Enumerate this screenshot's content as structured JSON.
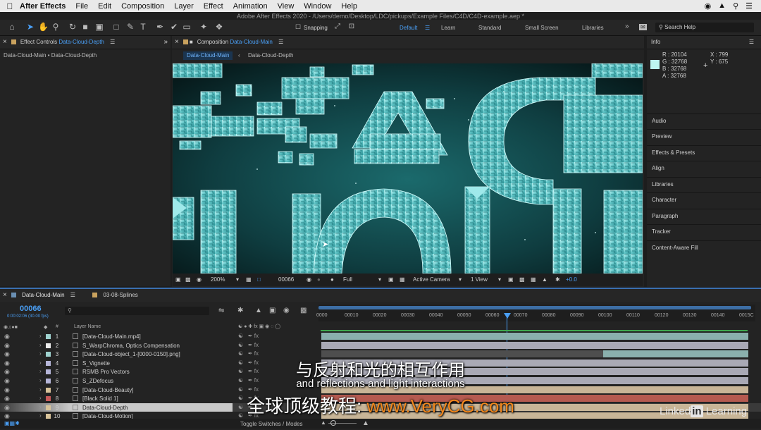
{
  "menubar": {
    "app_name": "After Effects",
    "items": [
      "File",
      "Edit",
      "Composition",
      "Layer",
      "Effect",
      "Animation",
      "View",
      "Window",
      "Help"
    ]
  },
  "window_title": "Adobe After Effects 2020 - /Users/demo/Desktop/LDC/pickups/Example Files/C4D/C4D-example.aep *",
  "toolbar": {
    "snapping": "Snapping",
    "workspaces": [
      "Default",
      "Learn",
      "Standard",
      "Small Screen",
      "Libraries"
    ],
    "active_workspace": "Default",
    "search_placeholder": "Search Help"
  },
  "effect_controls": {
    "header_prefix": "Effect Controls",
    "header_layer": "Data-Cloud-Depth",
    "breadcrumb": "Data-Cloud-Main • Data-Cloud-Depth"
  },
  "composition": {
    "header_prefix": "Composition",
    "header_name": "Data-Cloud-Main",
    "tabs": [
      "Data-Cloud-Main",
      "Data-Cloud-Depth"
    ],
    "zoom": "200%",
    "timecode": "00066",
    "resolution": "Full",
    "camera": "Active Camera",
    "view": "1 View",
    "exposure": "+0.0"
  },
  "info": {
    "title": "Info",
    "r": "R : 20104",
    "g": "G : 32768",
    "b": "B : 32768",
    "a": "A : 32768",
    "x": "X : 799",
    "y": "Y : 675",
    "swatch_color": "#bdf5f0"
  },
  "right_panels": [
    "Audio",
    "Preview",
    "Effects & Presets",
    "Align",
    "Libraries",
    "Character",
    "Paragraph",
    "Tracker",
    "Content-Aware Fill"
  ],
  "timeline": {
    "tabs": [
      "Data-Cloud-Main",
      "03-08-Splines"
    ],
    "current_frame": "00066",
    "current_time": "0:00:02:06 (30.00 fps)",
    "col_hash": "#",
    "col_layer_name": "Layer Name",
    "ruler": [
      "0000",
      "00010",
      "00020",
      "00030",
      "00040",
      "00050",
      "00060",
      "00070",
      "00080",
      "00090",
      "00100",
      "00110",
      "00120",
      "00130",
      "00140",
      "0015C"
    ],
    "layers": [
      {
        "num": "1",
        "name": "[Data-Cloud-Main.mp4]",
        "label": "#9fd2cf",
        "bar": "#8ab0ad"
      },
      {
        "num": "2",
        "name": "S_WarpChroma, Optics Compensation",
        "label": "#ececec",
        "bar": "#a9a9b5"
      },
      {
        "num": "3",
        "name": "[Data-Cloud-object_1-[0000-0150].png]",
        "label": "#9fd2cf",
        "bar": "#8ab0ad"
      },
      {
        "num": "4",
        "name": "S_Vignette",
        "label": "#b6b6d9",
        "bar": "#a9a9b5"
      },
      {
        "num": "5",
        "name": "RSMB Pro Vectors",
        "label": "#b6b6d9",
        "bar": "#a9a9b5"
      },
      {
        "num": "6",
        "name": "S_ZDefocus",
        "label": "#b6b6d9",
        "bar": "#a9a9b5"
      },
      {
        "num": "7",
        "name": "[Data-Cloud-Beauty]",
        "label": "#d8c39a",
        "bar": "#c8b597"
      },
      {
        "num": "8",
        "name": "[Black Solid 1]",
        "label": "#c85a5a",
        "bar": "#b55a50"
      },
      {
        "num": "9",
        "name": "Data-Cloud-Depth",
        "label": "#d8c39a",
        "bar": "#c8b597"
      },
      {
        "num": "10",
        "name": "[Data-Cloud-Motion]",
        "label": "#d8c39a",
        "bar": "#c8b597"
      }
    ],
    "footer": "Toggle Switches / Modes"
  },
  "subtitles": {
    "zh": "与反射和光的相互作用",
    "en": "and reflections and light interactions",
    "site_prefix": "全球顶级教程:",
    "site_url": "www.VeryCG.com"
  },
  "watermark": {
    "linked": "Linked",
    "in": "in",
    "learning": "Learning"
  }
}
